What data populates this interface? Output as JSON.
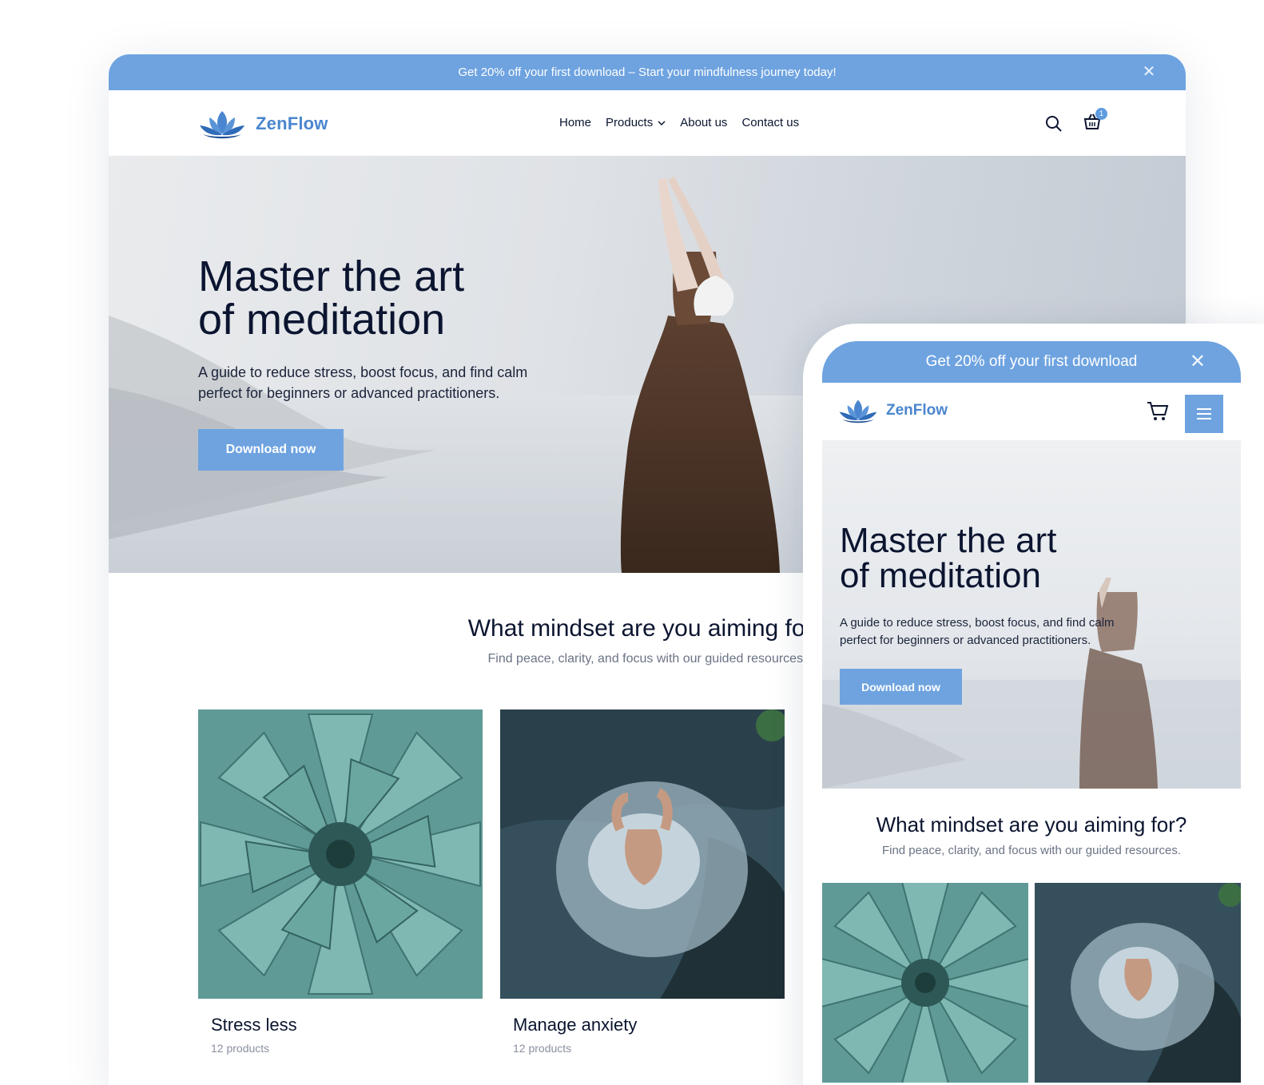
{
  "colors": {
    "accent": "#6ea3e0",
    "brand_text": "#4a86cf",
    "heading": "#0b1530"
  },
  "desktop": {
    "announcement": {
      "text": "Get 20% off your first download – Start your mindfulness journey today!",
      "close_icon": "close-icon"
    },
    "logo": {
      "text": "ZenFlow",
      "icon": "lotus-icon"
    },
    "nav": {
      "home": "Home",
      "products": "Products",
      "about": "About us",
      "contact": "Contact us"
    },
    "cart_count": "1",
    "hero": {
      "title_line1": "Master the art",
      "title_line2": "of meditation",
      "description": "A guide to reduce stress, boost focus, and find calm perfect for beginners or advanced practitioners.",
      "cta": "Download now"
    },
    "collections": {
      "title": "What mindset are you aiming for?",
      "subtitle": "Find peace, clarity, and focus with our guided resources.",
      "items": [
        {
          "name": "Stress less",
          "count": "12 products"
        },
        {
          "name": "Manage anxiety",
          "count": "12 products"
        }
      ]
    }
  },
  "mobile": {
    "announcement": {
      "text": "Get 20% off your first download",
      "close_icon": "close-icon"
    },
    "logo": {
      "text": "ZenFlow"
    },
    "hero": {
      "title_line1": "Master the art",
      "title_line2": "of meditation",
      "description": "A guide to reduce stress, boost focus, and find calm perfect for beginners or advanced practitioners.",
      "cta": "Download now"
    },
    "collections": {
      "title": "What mindset are you aiming for?",
      "subtitle": "Find peace, clarity, and focus with our guided resources."
    }
  }
}
